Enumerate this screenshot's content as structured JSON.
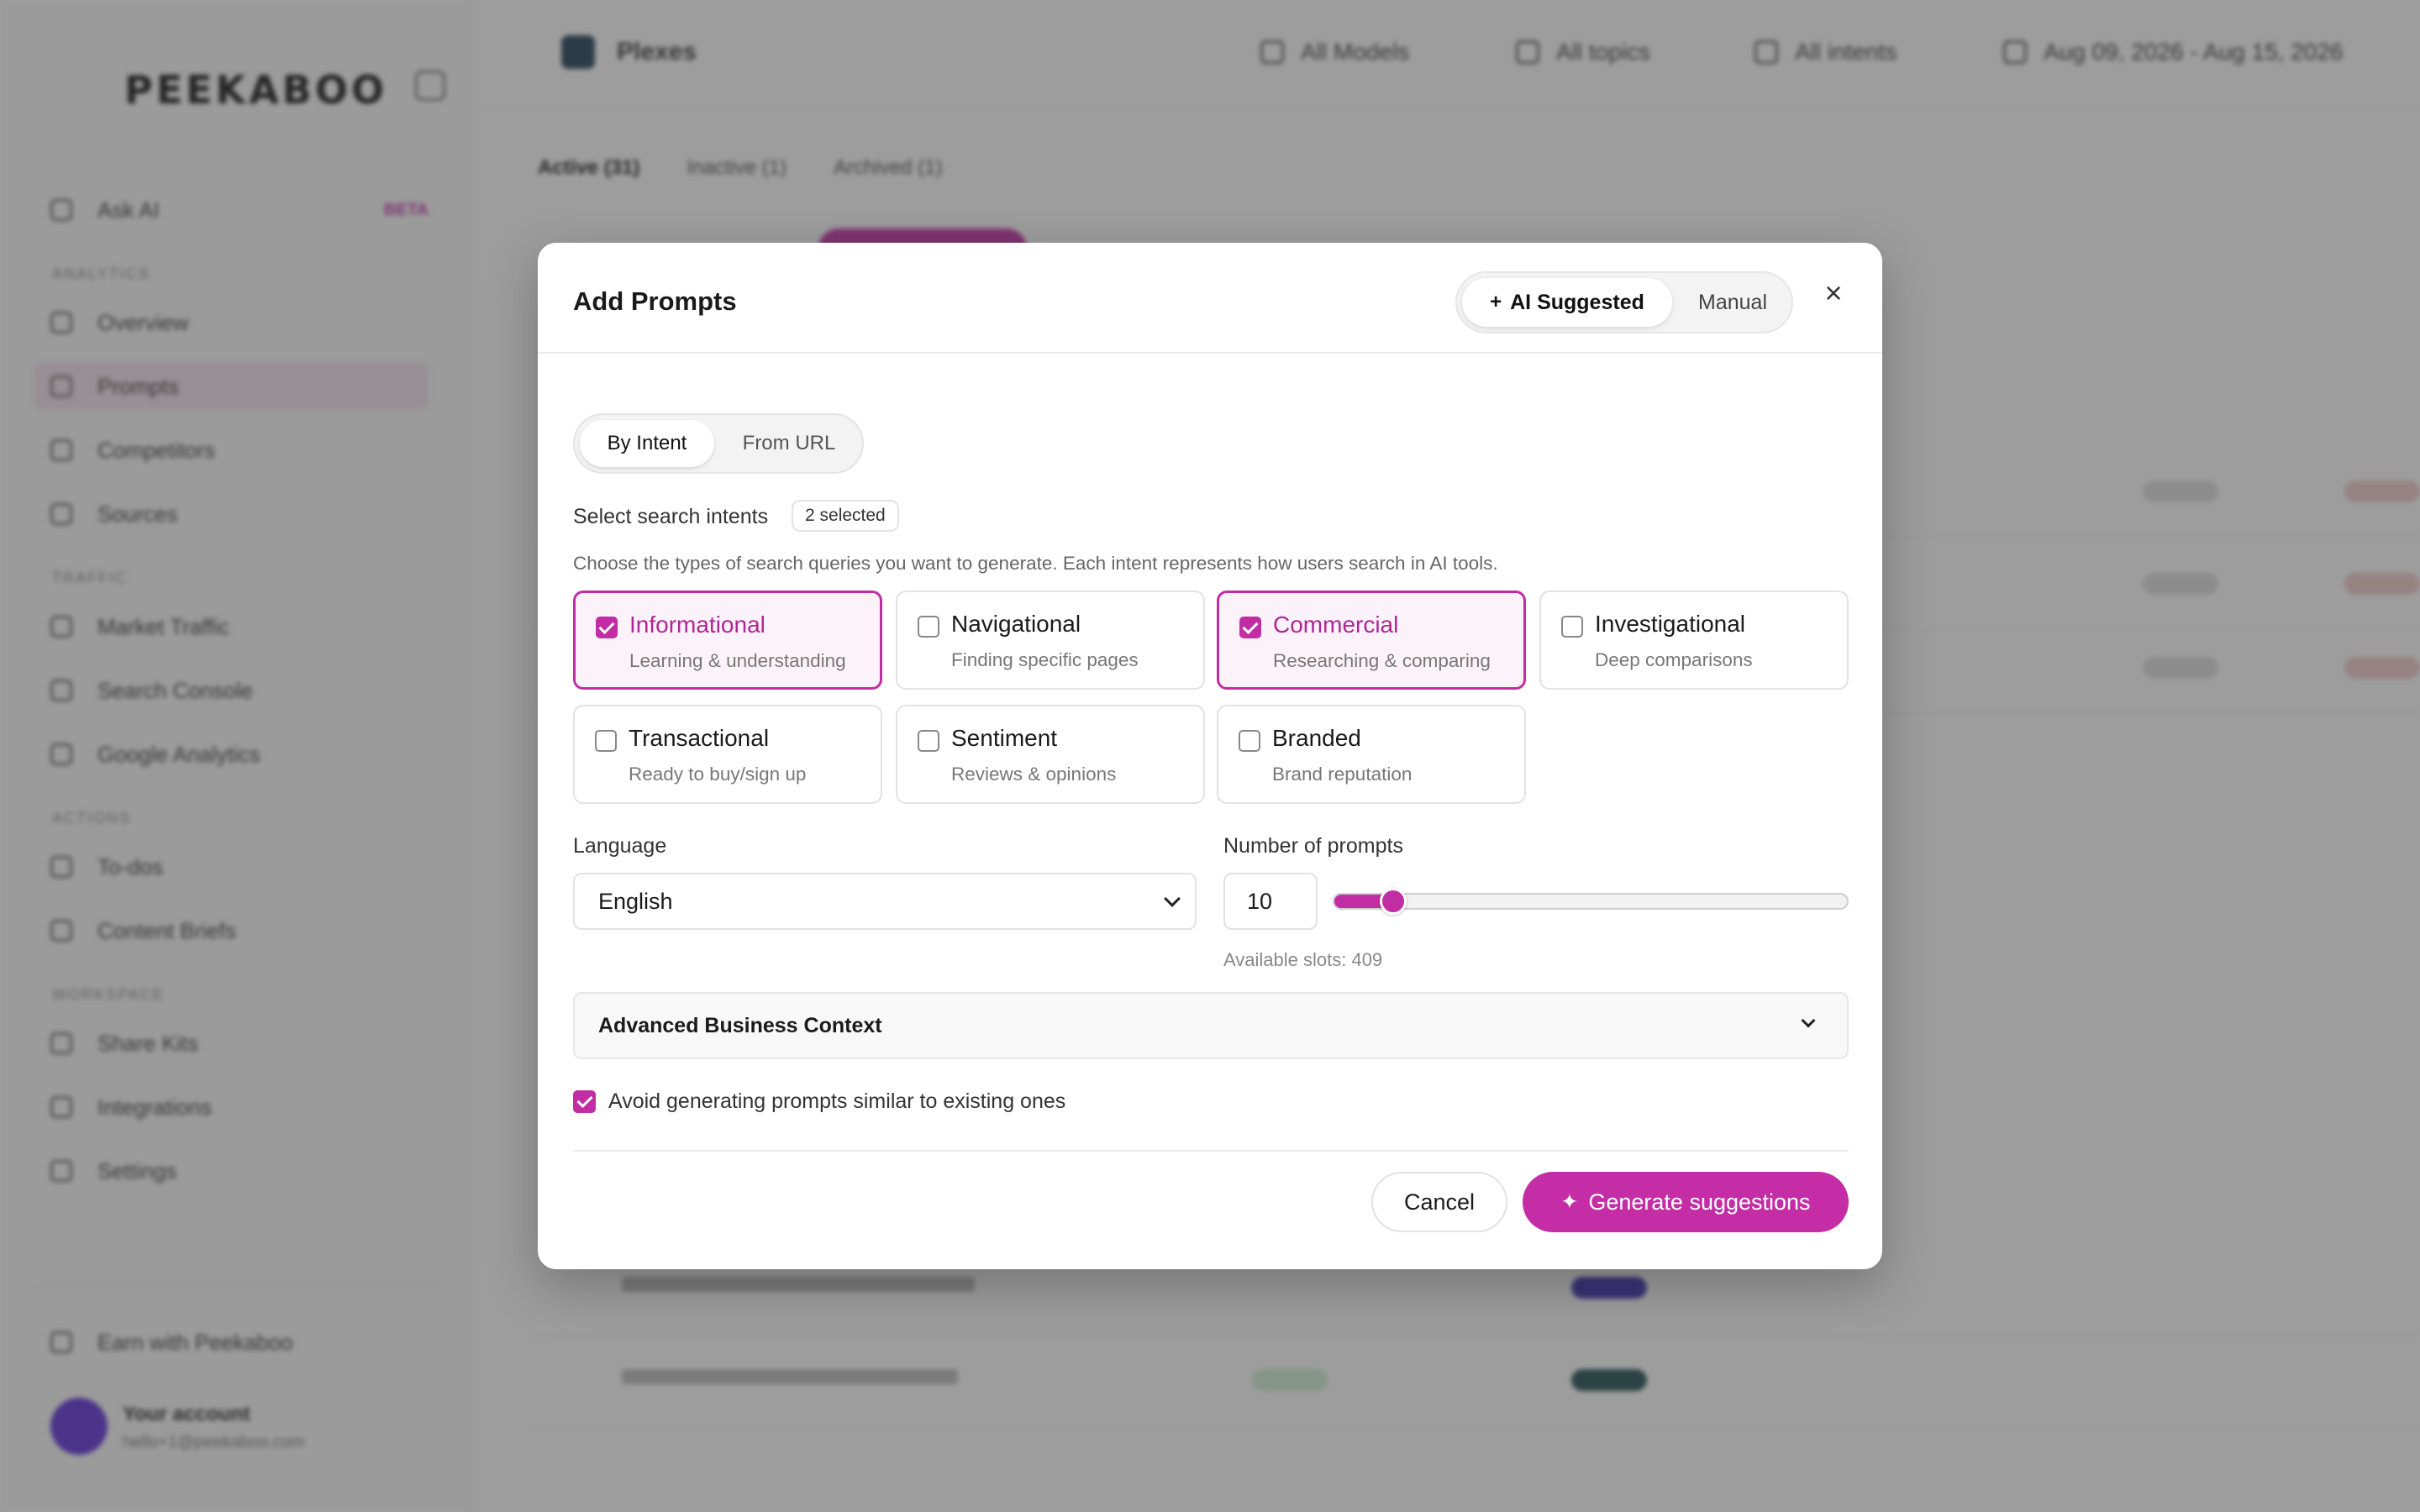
{
  "background": {
    "logo": "PEEKABOO",
    "sidebar": {
      "items": [
        {
          "label": "Ask AI",
          "badge": "BETA"
        },
        {
          "label": "Overview"
        },
        {
          "label": "Prompts"
        },
        {
          "label": "Competitors"
        },
        {
          "label": "Sources"
        },
        {
          "label": "Market Traffic"
        },
        {
          "label": "Search Console"
        },
        {
          "label": "Google Analytics"
        },
        {
          "label": "To-dos"
        },
        {
          "label": "Content Briefs"
        },
        {
          "label": "Share Kits"
        },
        {
          "label": "Integrations"
        },
        {
          "label": "Settings"
        }
      ],
      "bottom_item": "Earn with Peekaboo",
      "account_name": "Your account",
      "account_email": "hello+1@peekaboo.com"
    },
    "topbar": {
      "project": "Plexes",
      "filters": [
        "All Models",
        "All topics",
        "All intents",
        "Aug 09, 2026 - Aug 15, 2026"
      ]
    },
    "tabs": [
      "Active (31)",
      "Inactive (1)",
      "Archived (1)"
    ]
  },
  "modal": {
    "title": "Add Prompts",
    "mode_ai": "AI Suggested",
    "mode_manual": "Manual",
    "sub_by_intent": "By Intent",
    "sub_from_url": "From URL",
    "intent_label": "Select search intents",
    "selected_badge": "2 selected",
    "intent_description": "Choose the types of search queries you want to generate. Each intent represents how users search in AI tools.",
    "intents": [
      {
        "title": "Informational",
        "subtitle": "Learning & understanding",
        "checked": true
      },
      {
        "title": "Navigational",
        "subtitle": "Finding specific pages",
        "checked": false
      },
      {
        "title": "Commercial",
        "subtitle": "Researching & comparing",
        "checked": true
      },
      {
        "title": "Investigational",
        "subtitle": "Deep comparisons",
        "checked": false
      },
      {
        "title": "Transactional",
        "subtitle": "Ready to buy/sign up",
        "checked": false
      },
      {
        "title": "Sentiment",
        "subtitle": "Reviews & opinions",
        "checked": false
      },
      {
        "title": "Branded",
        "subtitle": "Brand reputation",
        "checked": false
      }
    ],
    "language_label": "Language",
    "language_value": "English",
    "prompts_label": "Number of prompts",
    "prompts_value": "10",
    "slider_fraction": 0.115,
    "available_slots": "Available slots: 409",
    "advanced_label": "Advanced Business Context",
    "avoid_label": "Avoid generating prompts similar to existing ones",
    "cancel_label": "Cancel",
    "generate_label": "Generate suggestions",
    "accent_color": "#c32da4"
  }
}
